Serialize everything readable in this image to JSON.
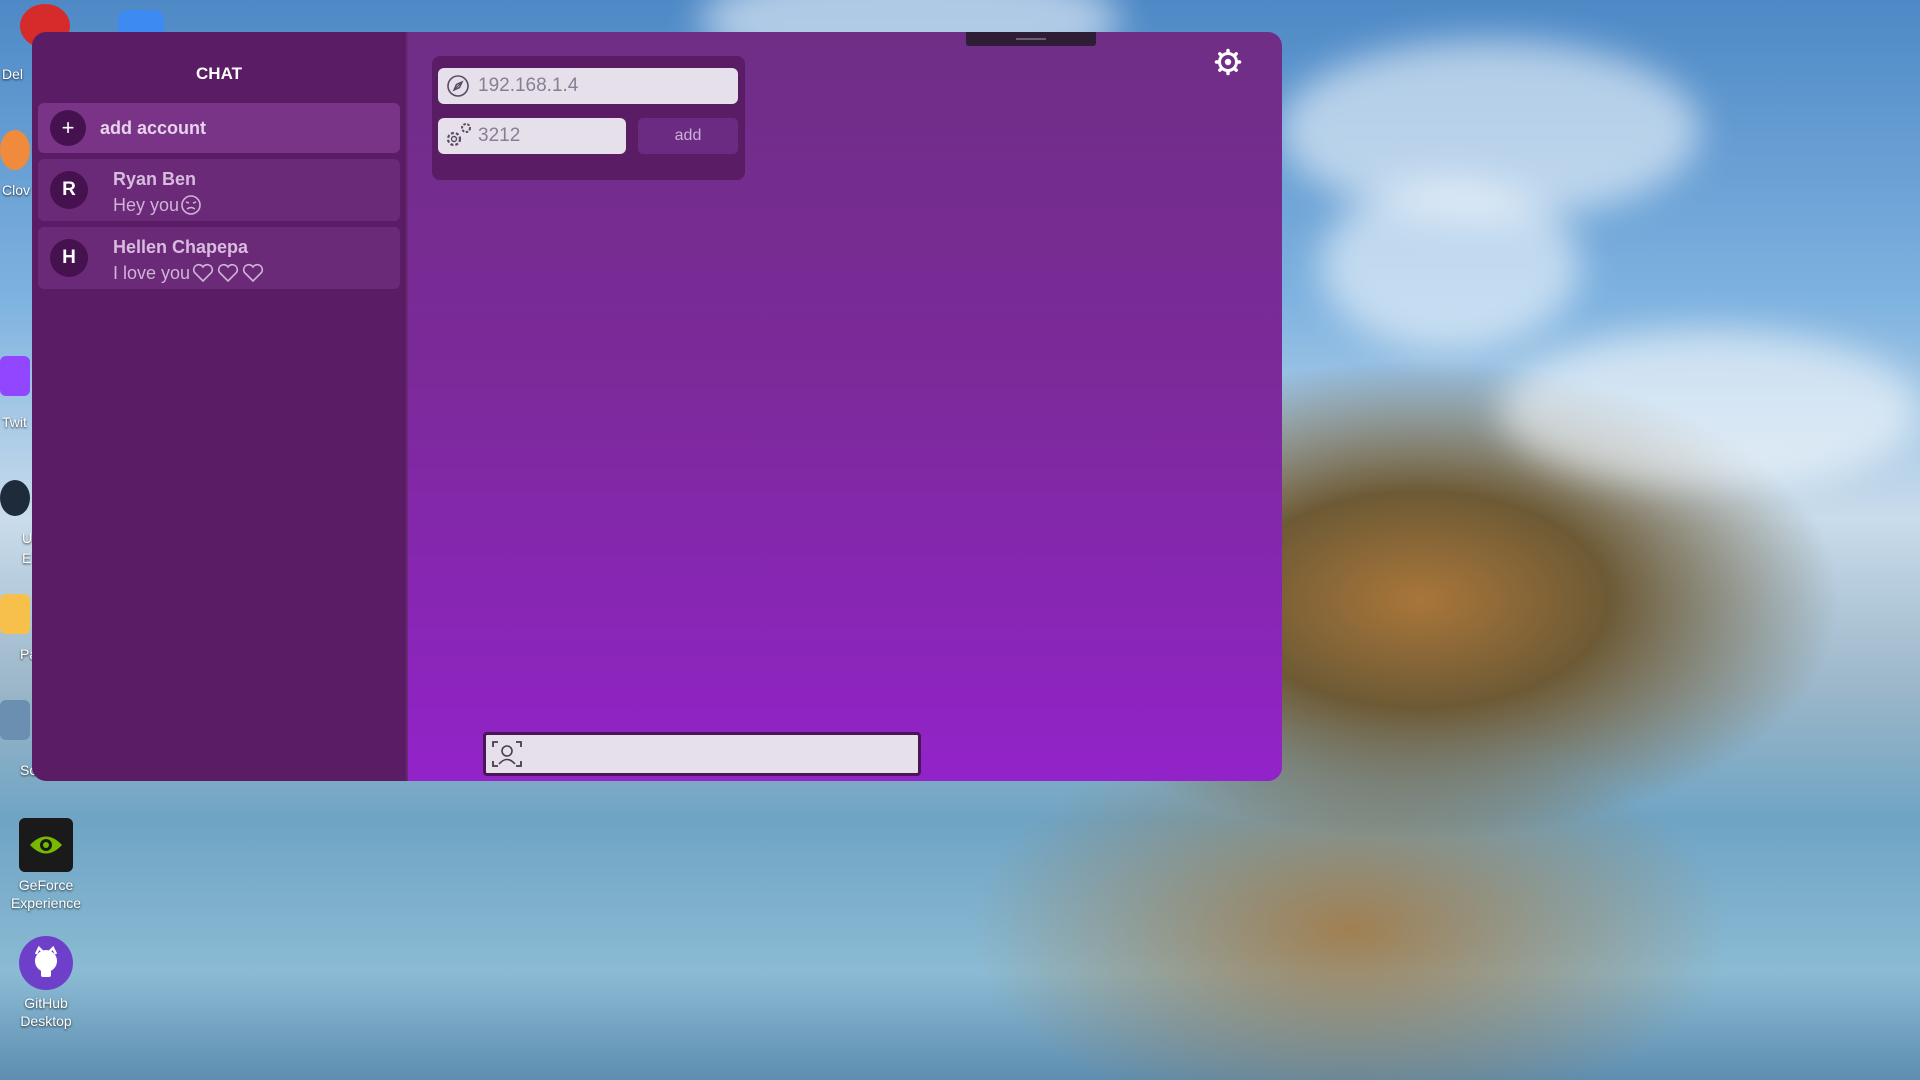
{
  "desktop": {
    "icons": [
      {
        "label": "GeForce\nExperience",
        "icon": "geforce-icon"
      },
      {
        "label": "GitHub\nDesktop",
        "icon": "github-icon"
      }
    ],
    "edge_labels": [
      "Del",
      "Clov",
      "Twit",
      "U\nE",
      "Pa",
      "So"
    ]
  },
  "sidebar": {
    "title": "CHAT",
    "add_account": {
      "icon": "+",
      "label": "add account"
    },
    "contacts": [
      {
        "initial": "R",
        "name": "Ryan Ben",
        "message": "Hey you",
        "emoji": "angry-face-icon"
      },
      {
        "initial": "H",
        "name": "Hellen Chapepa",
        "message": "I love you",
        "emoji": "heart-icon x3"
      }
    ]
  },
  "connection": {
    "ip_value": "192.168.1.4",
    "port_value": "3212",
    "add_label": "add"
  },
  "composer": {
    "value": "",
    "icon": "face-scan-icon"
  },
  "colors": {
    "sidebar_bg": "#5b1c66",
    "main_gradient_top": "#6f2e86",
    "main_gradient_bottom": "#9223c9",
    "field_bg": "#e6e0ea"
  }
}
